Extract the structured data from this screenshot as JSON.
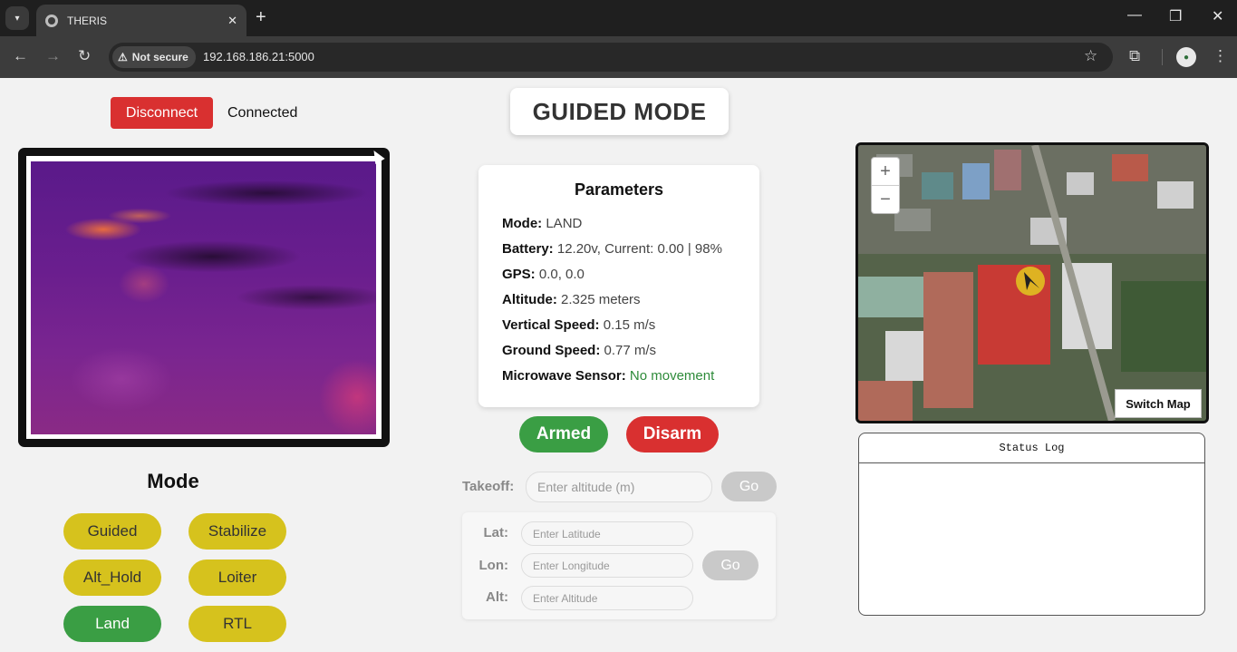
{
  "browser": {
    "tab_title": "THERIS",
    "security_chip": "Not secure",
    "url": "192.168.186.21:5000",
    "icons": [
      "tab-list-icon",
      "close-icon",
      "new-tab-icon",
      "minimize-icon",
      "restore-icon",
      "window-close-icon",
      "back-icon",
      "forward-icon",
      "reload-icon",
      "warning-icon",
      "star-icon",
      "extensions-icon",
      "profile-icon",
      "menu-icon"
    ]
  },
  "connection": {
    "disconnect_label": "Disconnect",
    "status": "Connected"
  },
  "header": {
    "mode_title": "GUIDED MODE"
  },
  "parameters": {
    "title": "Parameters",
    "rows": [
      {
        "label": "Mode:",
        "value": "LAND"
      },
      {
        "label": "Battery:",
        "value": "12.20v, Current: 0.00 | 98%"
      },
      {
        "label": "GPS:",
        "value": "0.0, 0.0"
      },
      {
        "label": "Altitude:",
        "value": "2.325 meters"
      },
      {
        "label": "Vertical Speed:",
        "value": "0.15 m/s"
      },
      {
        "label": "Ground Speed:",
        "value": "0.77 m/s"
      },
      {
        "label": "Microwave Sensor:",
        "value": "No movement"
      }
    ]
  },
  "arming": {
    "armed_label": "Armed",
    "disarm_label": "Disarm"
  },
  "takeoff": {
    "label": "Takeoff:",
    "placeholder": "Enter altitude (m)",
    "go_label": "Go"
  },
  "waypoint": {
    "lat_label": "Lat:",
    "lat_placeholder": "Enter Latitude",
    "lon_label": "Lon:",
    "lon_placeholder": "Enter Longitude",
    "alt_label": "Alt:",
    "alt_placeholder": "Enter Altitude",
    "go_label": "Go"
  },
  "modes": {
    "heading": "Mode",
    "buttons": [
      "Guided",
      "Stabilize",
      "Alt_Hold",
      "Loiter",
      "Land",
      "RTL"
    ],
    "active": "Land"
  },
  "map": {
    "zoom_in": "+",
    "zoom_out": "−",
    "switch_label": "Switch Map"
  },
  "status_log": {
    "title": "Status Log"
  },
  "colors": {
    "danger": "#d93030",
    "success": "#3a9e44",
    "mode_button": "#d6c21d",
    "ok_text": "#2e8b3a"
  }
}
